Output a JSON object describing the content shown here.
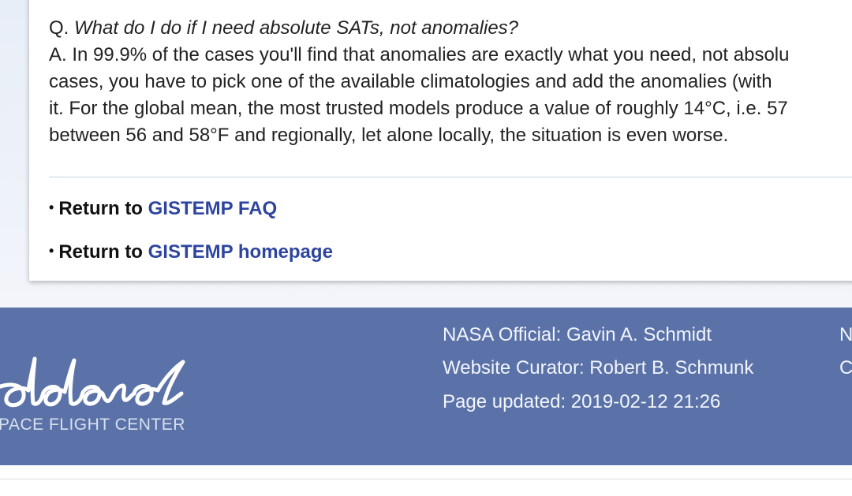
{
  "faq": {
    "question_prefix": "Q.",
    "question_text": "What do I do if I need absolute SATs, not anomalies?",
    "answer_lines": [
      "A. In 99.9% of the cases you'll find that anomalies are exactly what you need, not absolu",
      "cases, you have to pick one of the available climatologies and add the anomalies (with",
      "it. For the global mean, the most trusted models produce a value of roughly 14°C, i.e. 57",
      "between 56 and 58°F and regionally, let alone locally, the situation is even worse."
    ]
  },
  "links": {
    "faq_prefix": "Return to",
    "faq_label": "GISTEMP FAQ",
    "home_prefix": "Return to",
    "home_label": "GISTEMP homepage"
  },
  "footer": {
    "logo_script": "ddard",
    "logo_subtitle": "PACE FLIGHT CENTER",
    "official": "NASA Official: Gavin A. Schmidt",
    "curator": "Website Curator: Robert B. Schmunk",
    "updated": "Page updated: 2019-02-12 21:26",
    "cut_right_1": "N",
    "cut_right_2": "C"
  },
  "colors": {
    "link": "#2d45a0",
    "footer_bg": "#5b72a8"
  }
}
